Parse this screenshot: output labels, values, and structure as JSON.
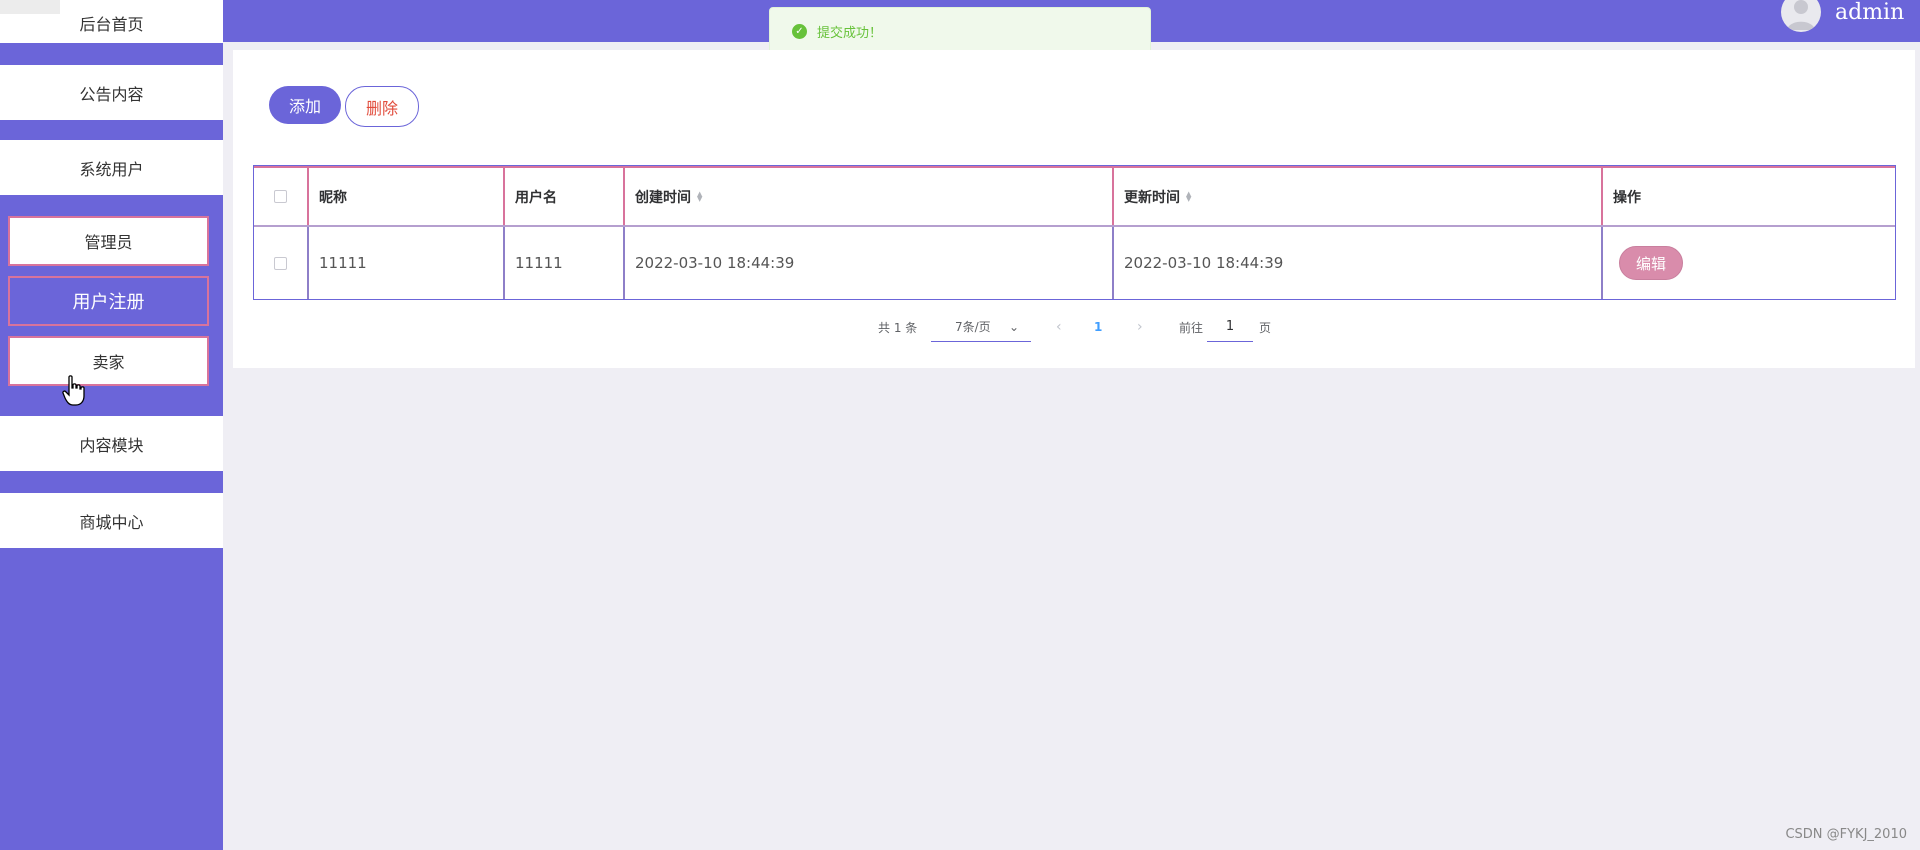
{
  "sidebar": {
    "items": [
      {
        "label": "后台首页"
      },
      {
        "label": "公告内容"
      },
      {
        "label": "系统用户"
      },
      {
        "label": "管理员"
      },
      {
        "label": "用户注册"
      },
      {
        "label": "卖家"
      },
      {
        "label": "内容模块"
      },
      {
        "label": "商城中心"
      }
    ]
  },
  "header": {
    "username": "admin"
  },
  "toast": {
    "message": "提交成功！"
  },
  "toolbar": {
    "add_label": "添加",
    "delete_label": "删除"
  },
  "table": {
    "headers": [
      "昵称",
      "用户名",
      "创建时间",
      "更新时间",
      "操作"
    ],
    "rows": [
      {
        "nickname": "11111",
        "username": "11111",
        "created": "2022-03-10 18:44:39",
        "updated": "2022-03-10 18:44:39",
        "action": "编辑"
      }
    ]
  },
  "pagination": {
    "total_text": "共 1 条",
    "page_size": "7条/页",
    "current_page": "1",
    "goto_label": "前往",
    "goto_value": "1",
    "page_suffix": "页"
  },
  "watermark": "CSDN @FYKJ_2010",
  "colors": {
    "accent": "#6b65d9",
    "border_pink": "#d8739c",
    "edit_button": "#d98cab",
    "success": "#67c23a"
  }
}
